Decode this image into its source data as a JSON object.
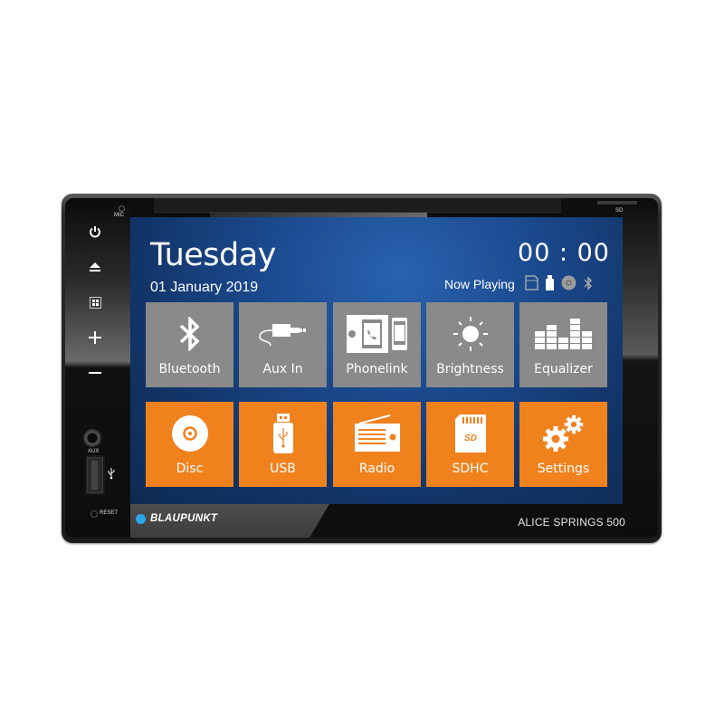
{
  "device": {
    "brand": "BLAUPUNKT",
    "model": "ALICE SPRINGS 500",
    "labels": {
      "mic": "MIC",
      "sd": "SD",
      "aux": "AUX",
      "reset": "RESET"
    },
    "hardware_buttons": [
      {
        "name": "power",
        "icon": "power-icon"
      },
      {
        "name": "eject",
        "icon": "eject-icon"
      },
      {
        "name": "home",
        "icon": "grid-icon"
      },
      {
        "name": "volume-up",
        "icon": "plus-icon"
      },
      {
        "name": "volume-down",
        "icon": "minus-icon"
      }
    ],
    "colors": {
      "brand_dot": "#2aa7e8",
      "tile_gray": "#8a8a8a",
      "tile_orange": "#f0821e",
      "screen_bg": "#1b4a8f"
    }
  },
  "screen": {
    "day": "Tuesday",
    "date": "01 January 2019",
    "clock": "00 : 00",
    "now_playing_label": "Now Playing",
    "source_icons": [
      "sd-card-icon",
      "usb-icon",
      "disc-icon",
      "bluetooth-icon"
    ],
    "tiles_row1": [
      {
        "label": "Bluetooth",
        "icon": "bluetooth-icon"
      },
      {
        "label": "Aux In",
        "icon": "aux-cable-icon"
      },
      {
        "label": "Phonelink",
        "icon": "phonelink-icon"
      },
      {
        "label": "Brightness",
        "icon": "sun-icon"
      },
      {
        "label": "Equalizer",
        "icon": "equalizer-icon"
      }
    ],
    "tiles_row2": [
      {
        "label": "Disc",
        "icon": "disc-icon"
      },
      {
        "label": "USB",
        "icon": "usb-drive-icon"
      },
      {
        "label": "Radio",
        "icon": "radio-icon"
      },
      {
        "label": "SDHC",
        "icon": "sd-card-icon"
      },
      {
        "label": "Settings",
        "icon": "gears-icon"
      }
    ]
  }
}
